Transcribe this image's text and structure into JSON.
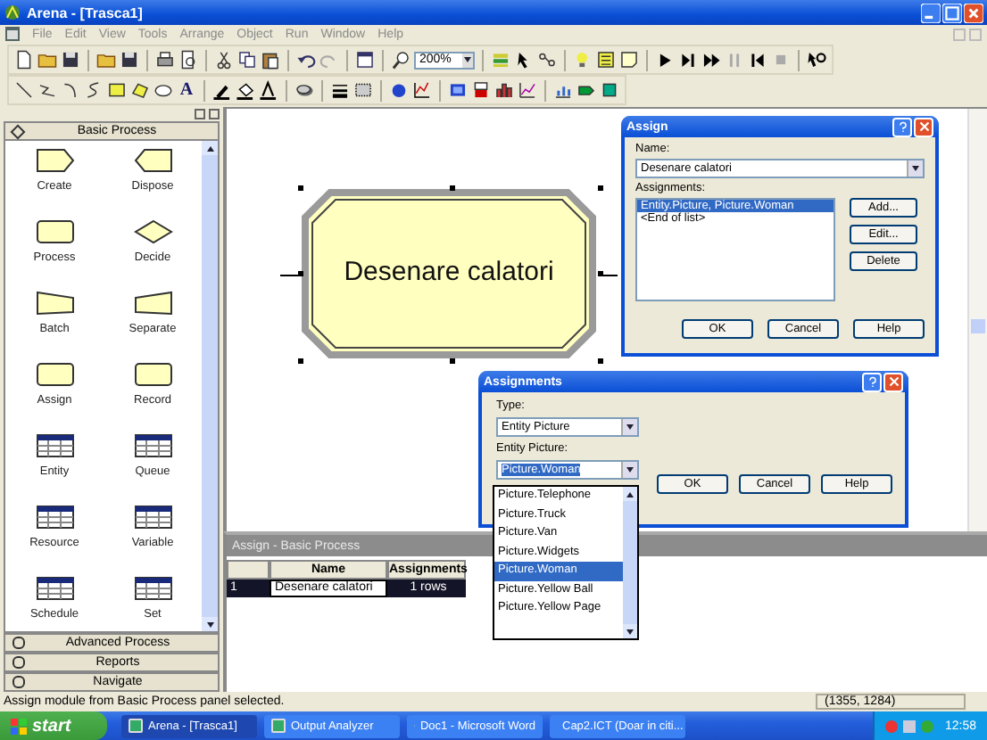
{
  "window": {
    "title": "Arena - [Trasca1]"
  },
  "menu": [
    "File",
    "Edit",
    "View",
    "Tools",
    "Arrange",
    "Object",
    "Run",
    "Window",
    "Help"
  ],
  "toolbar": {
    "zoom": "200%",
    "text_tool": "A"
  },
  "panel": {
    "title": "Basic Process",
    "modules": [
      {
        "label": "Create",
        "kind": "create"
      },
      {
        "label": "Dispose",
        "kind": "dispose"
      },
      {
        "label": "Process",
        "kind": "process"
      },
      {
        "label": "Decide",
        "kind": "decide"
      },
      {
        "label": "Batch",
        "kind": "batch"
      },
      {
        "label": "Separate",
        "kind": "separate"
      },
      {
        "label": "Assign",
        "kind": "process"
      },
      {
        "label": "Record",
        "kind": "process"
      },
      {
        "label": "Entity",
        "kind": "table"
      },
      {
        "label": "Queue",
        "kind": "table"
      },
      {
        "label": "Resource",
        "kind": "table"
      },
      {
        "label": "Variable",
        "kind": "table"
      },
      {
        "label": "Schedule",
        "kind": "table"
      },
      {
        "label": "Set",
        "kind": "table"
      }
    ],
    "sections": [
      "Advanced Process",
      "Reports",
      "Navigate"
    ]
  },
  "canvas": {
    "module_label": "Desenare calatori"
  },
  "spreadsheet": {
    "title": "Assign - Basic Process",
    "columns": [
      "Name",
      "Assignments"
    ],
    "rows": [
      {
        "index": "1",
        "name": "Desenare calatori",
        "assignments": "1 rows"
      }
    ]
  },
  "assign_dialog": {
    "title": "Assign",
    "name_label": "Name:",
    "name_value": "Desenare calatori",
    "assignments_label": "Assignments:",
    "items": [
      {
        "text": "Entity.Picture, Picture.Woman",
        "selected": true
      },
      {
        "text": "<End of list>",
        "selected": false
      }
    ],
    "side_buttons": [
      "Add...",
      "Edit...",
      "Delete"
    ],
    "buttons": [
      "OK",
      "Cancel",
      "Help"
    ]
  },
  "assignments_dialog": {
    "title": "Assignments",
    "type_label": "Type:",
    "type_value": "Entity Picture",
    "picture_label": "Entity Picture:",
    "picture_value": "Picture.Woman",
    "options": [
      {
        "text": "Picture.Telephone",
        "selected": false
      },
      {
        "text": "Picture.Truck",
        "selected": false
      },
      {
        "text": "Picture.Van",
        "selected": false
      },
      {
        "text": "Picture.Widgets",
        "selected": false
      },
      {
        "text": "Picture.Woman",
        "selected": true
      },
      {
        "text": "Picture.Yellow Ball",
        "selected": false
      },
      {
        "text": "Picture.Yellow Page",
        "selected": false
      }
    ],
    "buttons": [
      "OK",
      "Cancel",
      "Help"
    ]
  },
  "status_bar": {
    "message": "Assign module from Basic Process panel selected.",
    "coordinates": "(1355, 1284)"
  },
  "taskbar": {
    "start": "start",
    "tasks": [
      {
        "label": "Arena - [Trasca1]",
        "selected": true
      },
      {
        "label": "Output Analyzer",
        "selected": false
      },
      {
        "label": "Doc1 - Microsoft Word",
        "selected": false
      },
      {
        "label": "Cap2.ICT (Doar in citi...",
        "selected": false
      }
    ],
    "clock": "12:58"
  }
}
